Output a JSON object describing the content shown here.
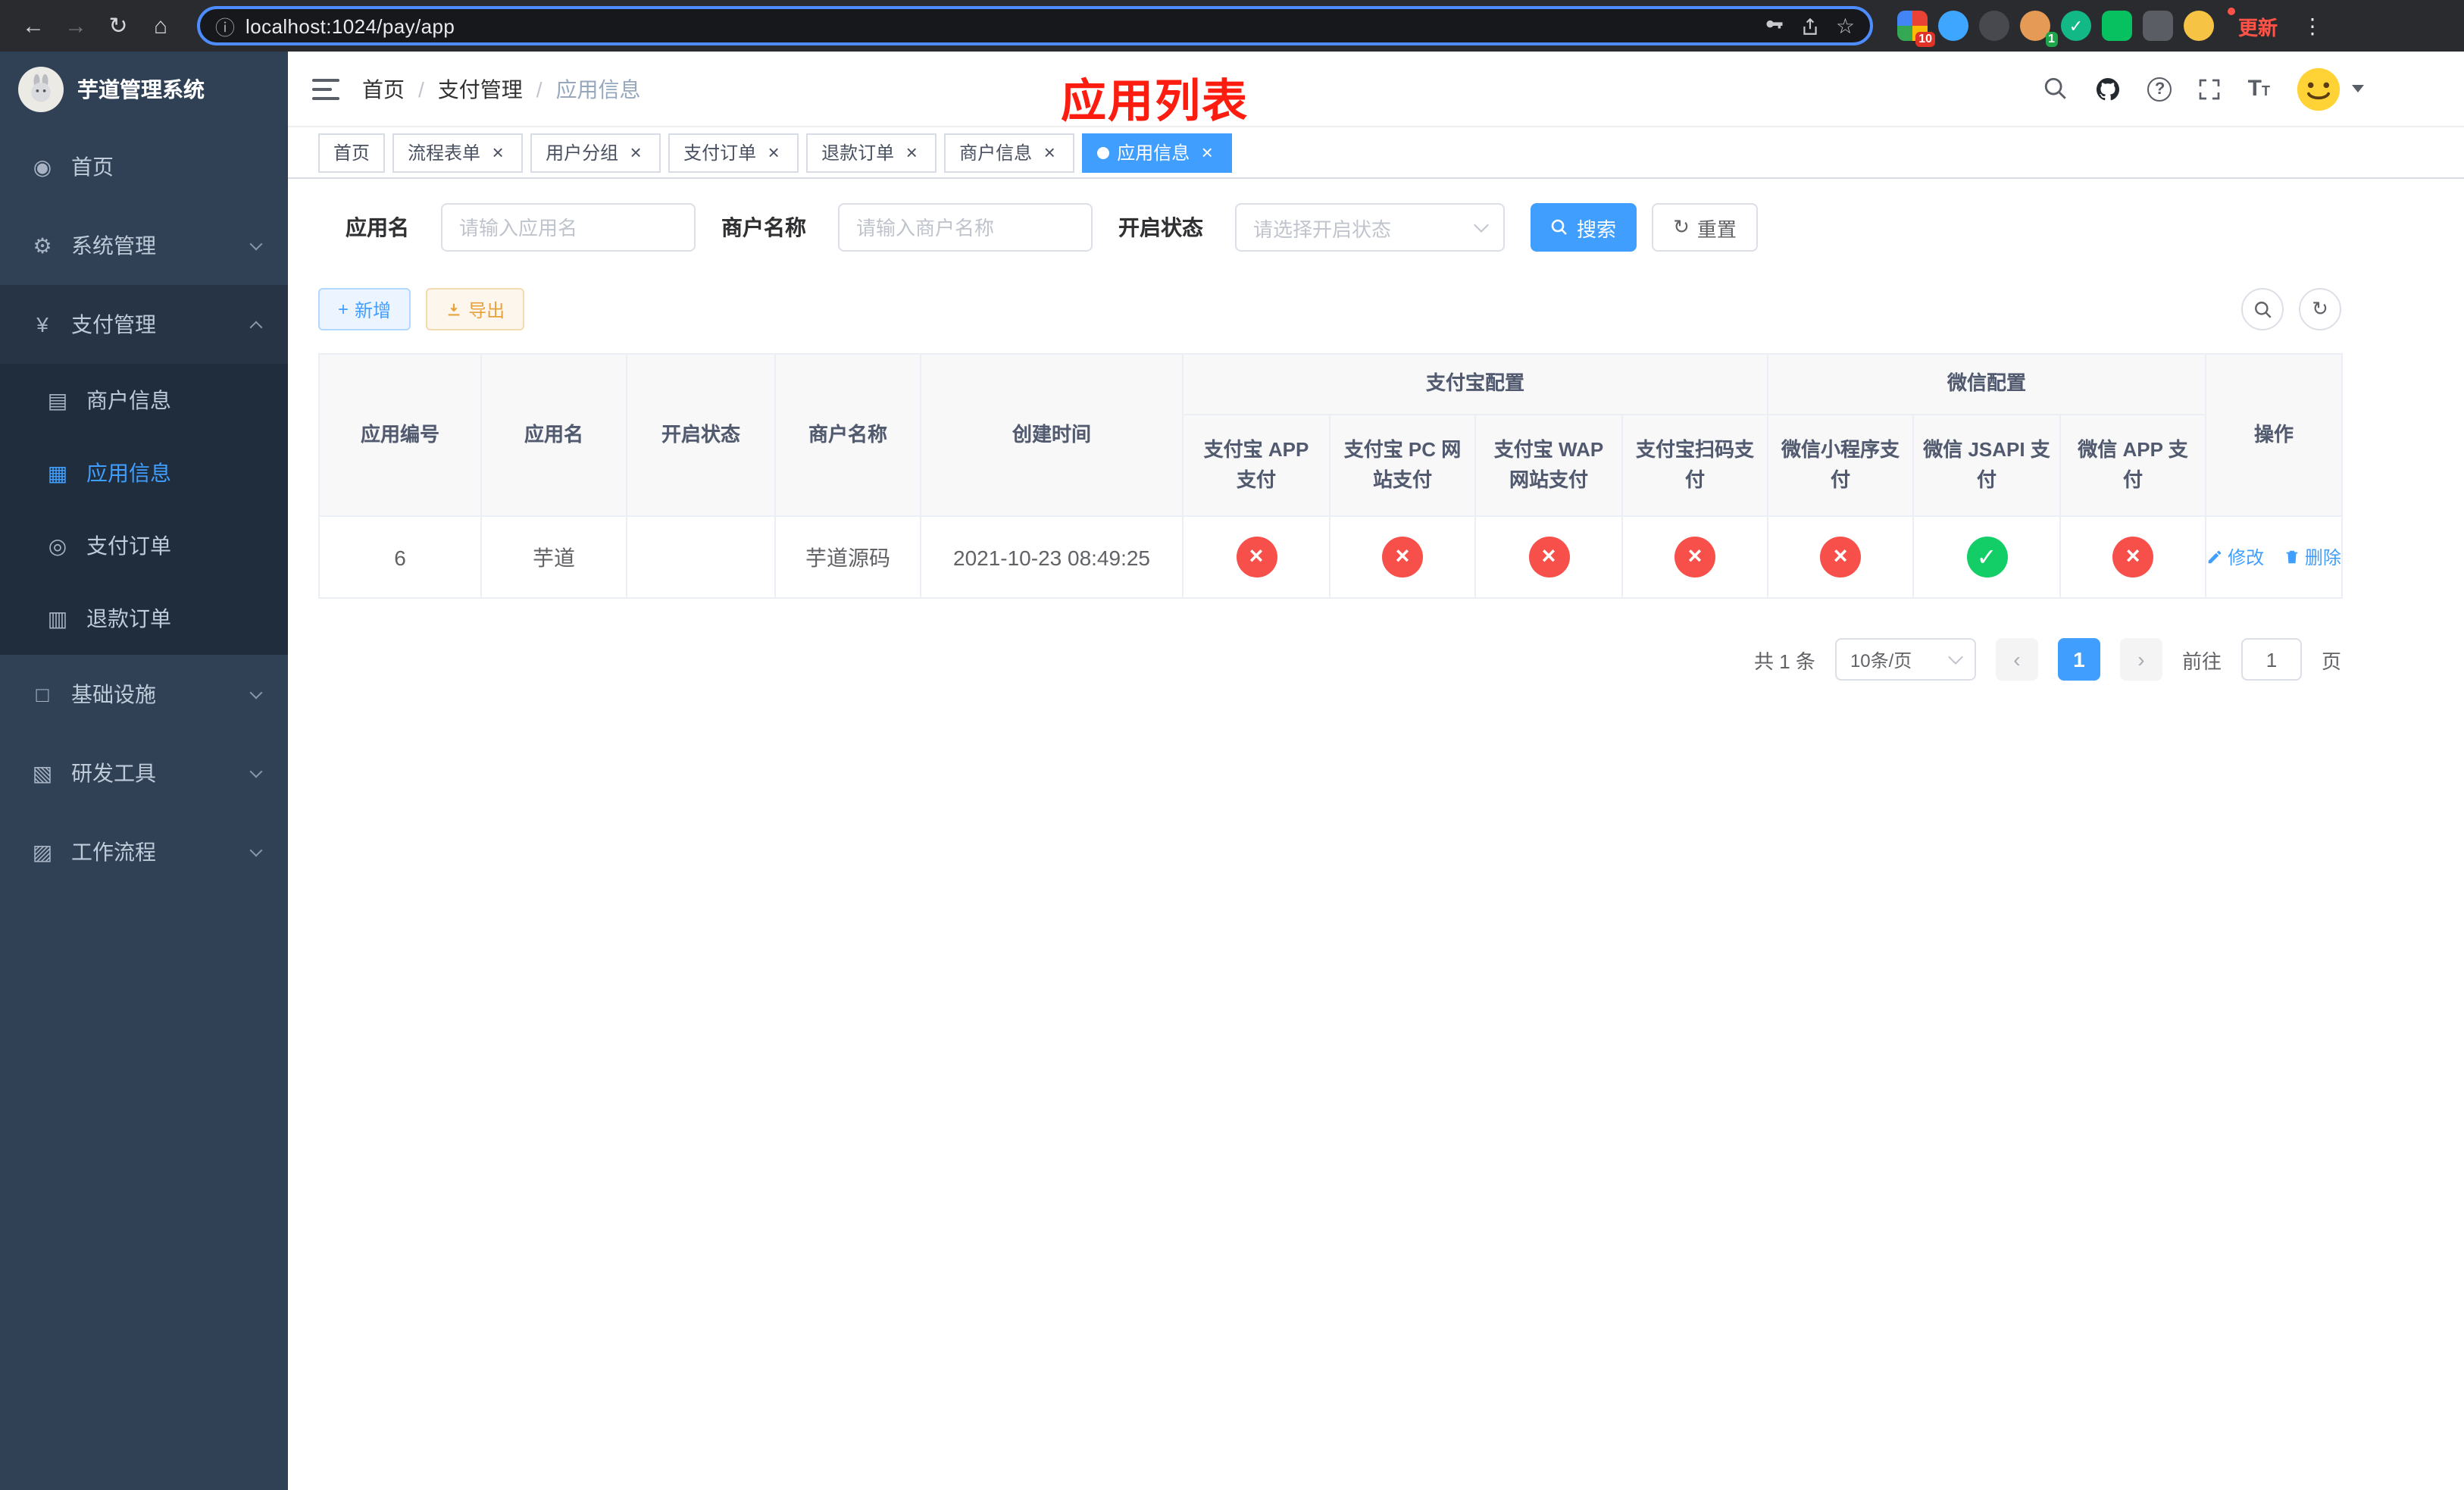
{
  "colors": {
    "primary": "#409eff",
    "success": "#13ce66",
    "danger": "#f7504a",
    "sidebar_bg": "#304156",
    "submenu_bg": "#1f2d3d",
    "title_red": "#fd1d10"
  },
  "browser": {
    "url": "localhost:1024/pay/app",
    "update_label": "更新",
    "extension_badge_1": "10",
    "extension_badge_2": "1"
  },
  "sidebar": {
    "title": "芋道管理系统",
    "menu": [
      {
        "label": "首页"
      },
      {
        "label": "系统管理"
      },
      {
        "label": "支付管理"
      },
      {
        "label": "基础设施"
      },
      {
        "label": "研发工具"
      },
      {
        "label": "工作流程"
      }
    ],
    "submenu": [
      {
        "label": "商户信息"
      },
      {
        "label": "应用信息"
      },
      {
        "label": "支付订单"
      },
      {
        "label": "退款订单"
      }
    ]
  },
  "breadcrumb": [
    "首页",
    "支付管理",
    "应用信息"
  ],
  "page_title": "应用列表",
  "tabs": [
    {
      "label": "首页"
    },
    {
      "label": "流程表单"
    },
    {
      "label": "用户分组"
    },
    {
      "label": "支付订单"
    },
    {
      "label": "退款订单"
    },
    {
      "label": "商户信息"
    },
    {
      "label": "应用信息"
    }
  ],
  "filters": {
    "app_name_label": "应用名",
    "app_name_placeholder": "请输入应用名",
    "merchant_label": "商户名称",
    "merchant_placeholder": "请输入商户名称",
    "status_label": "开启状态",
    "status_placeholder": "请选择开启状态",
    "search_button": "搜索",
    "reset_button": "重置"
  },
  "toolbar": {
    "add_button": "新增",
    "export_button": "导出"
  },
  "table": {
    "columns": {
      "id": "应用编号",
      "name": "应用名",
      "status": "开启状态",
      "merchant": "商户名称",
      "created": "创建时间",
      "ops": "操作"
    },
    "alipay_group": "支付宝配置",
    "alipay_cols": [
      "支付宝 APP 支付",
      "支付宝 PC 网站支付",
      "支付宝 WAP 网站支付",
      "支付宝扫码支付"
    ],
    "wechat_group": "微信配置",
    "wechat_cols": [
      "微信小程序支付",
      "微信 JSAPI 支付",
      "微信 APP 支付"
    ],
    "rows": [
      {
        "id": "6",
        "name": "芋道",
        "status_on": true,
        "merchant": "芋道源码",
        "created": "2021-10-23 08:49:25",
        "alipay_app": false,
        "alipay_pc": false,
        "alipay_wap": false,
        "alipay_scan": false,
        "wechat_mini": false,
        "wechat_jsapi": true,
        "wechat_app": false,
        "edit_label": "修改",
        "delete_label": "删除"
      }
    ]
  },
  "pagination": {
    "total": "共 1 条",
    "page_size": "10条/页",
    "page": "1",
    "goto_label": "前往",
    "goto_value": "1",
    "goto_suffix": "页"
  }
}
